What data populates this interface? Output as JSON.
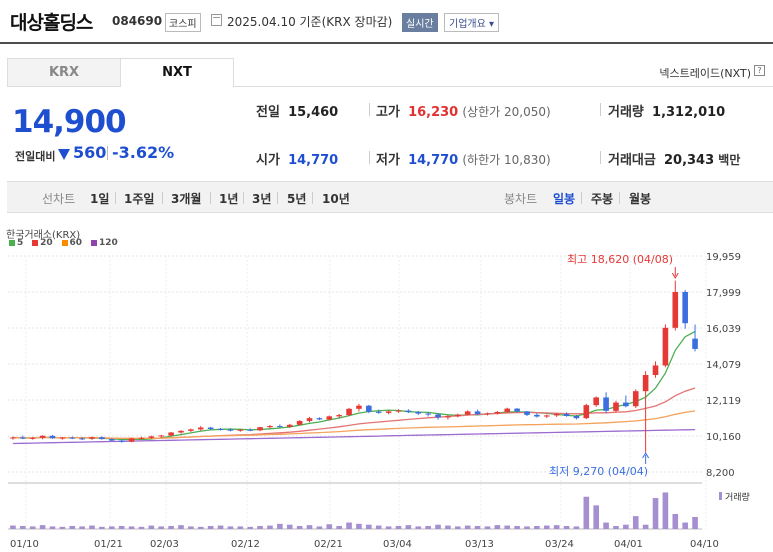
{
  "header": {
    "company_name": "대상홀딩스",
    "code": "084690",
    "market": "코스피",
    "date_text": "2025.04.10 기준(KRX 장마감)",
    "live_label": "실시간",
    "overview_label": "기업개요 ▾"
  },
  "tabs": [
    {
      "label": "KRX",
      "selected": false
    },
    {
      "label": "NXT",
      "selected": true
    }
  ],
  "nxt_link": "넥스트레이드(NXT)",
  "help_icon": "?",
  "summary": {
    "price": "14,900",
    "change_label": "전일대비",
    "change_value": "560",
    "change_pct": "-3.62%",
    "direction": "down"
  },
  "stats": {
    "prev_label": "전일",
    "prev": "15,460",
    "high_label": "고가",
    "high": "16,230",
    "upper_limit_text": "(상한가 20,050)",
    "volume_label": "거래량",
    "volume": "1,312,010",
    "open_label": "시가",
    "open": "14,770",
    "low_label": "저가",
    "low": "14,770",
    "lower_limit_text": "(하한가 10,830)",
    "amount_label": "거래대금",
    "amount": "20,343",
    "amount_unit": "백만"
  },
  "periods": {
    "line_label": "선차트",
    "line_items": [
      "1일",
      "1주일",
      "3개월",
      "1년",
      "3년",
      "5년",
      "10년"
    ],
    "candle_label": "봉차트",
    "candle_items": [
      "일봉",
      "주봉",
      "월봉"
    ],
    "active_candle": "일봉"
  },
  "chart": {
    "source_label": "한국거래소(KRX)",
    "ma_legend": [
      {
        "label": "5",
        "color": "#4caf50"
      },
      {
        "label": "20",
        "color": "#e53935"
      },
      {
        "label": "60",
        "color": "#fb8c00"
      },
      {
        "label": "120",
        "color": "#8e44ad"
      }
    ],
    "y_ticks": [
      "19,959",
      "17,999",
      "16,039",
      "14,079",
      "12,119",
      "10,160",
      "8,200"
    ],
    "x_ticks": [
      "01/10",
      "01/21",
      "02/03",
      "02/12",
      "02/21",
      "03/04",
      "03/13",
      "03/24",
      "04/01",
      "04/10"
    ],
    "high_note": "최고 18,620 (04/08)",
    "low_note": "최저 9,270 (04/04)",
    "volume_label": "거래량"
  },
  "chart_data": {
    "type": "candlestick",
    "y_range": [
      8200,
      19959
    ],
    "candles": [
      [
        10040,
        10120,
        9960,
        10080
      ],
      [
        10080,
        10180,
        9990,
        10020
      ],
      [
        10020,
        10110,
        9960,
        10060
      ],
      [
        10060,
        10200,
        9980,
        10170
      ],
      [
        10170,
        10210,
        10010,
        10040
      ],
      [
        10040,
        10110,
        9960,
        10070
      ],
      [
        10070,
        10130,
        9990,
        10030
      ],
      [
        10030,
        10100,
        9940,
        10010
      ],
      [
        10010,
        10130,
        9950,
        10090
      ],
      [
        10090,
        10140,
        9960,
        9990
      ],
      [
        9990,
        10040,
        9880,
        9910
      ],
      [
        9910,
        9960,
        9800,
        9850
      ],
      [
        9850,
        10070,
        9820,
        10030
      ],
      [
        10030,
        10120,
        9970,
        10060
      ],
      [
        10060,
        10180,
        10000,
        10140
      ],
      [
        10140,
        10220,
        10060,
        10190
      ],
      [
        10190,
        10380,
        10140,
        10350
      ],
      [
        10350,
        10470,
        10280,
        10440
      ],
      [
        10440,
        10560,
        10380,
        10520
      ],
      [
        10520,
        10700,
        10450,
        10620
      ],
      [
        10620,
        10660,
        10480,
        10540
      ],
      [
        10540,
        10600,
        10460,
        10510
      ],
      [
        10510,
        10590,
        10410,
        10450
      ],
      [
        10450,
        10550,
        10390,
        10500
      ],
      [
        10500,
        10580,
        10420,
        10470
      ],
      [
        10470,
        10660,
        10420,
        10640
      ],
      [
        10640,
        10760,
        10570,
        10700
      ],
      [
        10700,
        10790,
        10620,
        10660
      ],
      [
        10660,
        10820,
        10610,
        10770
      ],
      [
        10770,
        11020,
        10740,
        10980
      ],
      [
        10980,
        11200,
        10900,
        11130
      ],
      [
        11130,
        11180,
        11020,
        11060
      ],
      [
        11060,
        11280,
        11010,
        11230
      ],
      [
        11230,
        11360,
        11150,
        11300
      ],
      [
        11300,
        11690,
        11240,
        11640
      ],
      [
        11640,
        11900,
        11500,
        11810
      ],
      [
        11810,
        11850,
        11400,
        11480
      ],
      [
        11480,
        11600,
        11370,
        11420
      ],
      [
        11420,
        11560,
        11340,
        11500
      ],
      [
        11500,
        11610,
        11420,
        11540
      ],
      [
        11540,
        11620,
        11410,
        11470
      ],
      [
        11470,
        11520,
        11300,
        11380
      ],
      [
        11380,
        11460,
        11220,
        11330
      ],
      [
        11330,
        11400,
        11050,
        11170
      ],
      [
        11170,
        11290,
        11060,
        11230
      ],
      [
        11230,
        11380,
        11180,
        11320
      ],
      [
        11320,
        11560,
        11280,
        11500
      ],
      [
        11500,
        11590,
        11300,
        11350
      ],
      [
        11350,
        11440,
        11280,
        11390
      ],
      [
        11390,
        11520,
        11330,
        11470
      ],
      [
        11470,
        11700,
        11430,
        11650
      ],
      [
        11650,
        11680,
        11430,
        11500
      ],
      [
        11500,
        11520,
        11250,
        11310
      ],
      [
        11310,
        11400,
        11160,
        11220
      ],
      [
        11220,
        11330,
        11140,
        11280
      ],
      [
        11280,
        11420,
        11200,
        11360
      ],
      [
        11360,
        11450,
        11210,
        11250
      ],
      [
        11250,
        11310,
        11060,
        11130
      ],
      [
        11130,
        11910,
        11080,
        11840
      ],
      [
        11840,
        12310,
        11750,
        12260
      ],
      [
        12260,
        12540,
        11400,
        11530
      ],
      [
        11530,
        12080,
        11450,
        11980
      ],
      [
        11980,
        12360,
        11720,
        11780
      ],
      [
        11780,
        12700,
        11680,
        12600
      ],
      [
        12600,
        13690,
        9270,
        13480
      ],
      [
        13480,
        14220,
        13330,
        14000
      ],
      [
        14000,
        16230,
        13900,
        16050
      ],
      [
        16050,
        18620,
        15900,
        18000
      ],
      [
        18000,
        18100,
        16000,
        16300
      ],
      [
        15460,
        16230,
        14770,
        14900
      ]
    ],
    "volume": [
      0.08,
      0.07,
      0.06,
      0.09,
      0.06,
      0.05,
      0.07,
      0.06,
      0.08,
      0.05,
      0.06,
      0.07,
      0.06,
      0.05,
      0.08,
      0.06,
      0.07,
      0.09,
      0.06,
      0.05,
      0.07,
      0.08,
      0.06,
      0.06,
      0.05,
      0.07,
      0.08,
      0.12,
      0.1,
      0.07,
      0.09,
      0.06,
      0.11,
      0.07,
      0.15,
      0.12,
      0.1,
      0.08,
      0.06,
      0.07,
      0.09,
      0.06,
      0.07,
      0.1,
      0.08,
      0.06,
      0.08,
      0.07,
      0.06,
      0.09,
      0.08,
      0.07,
      0.06,
      0.07,
      0.08,
      0.09,
      0.07,
      0.06,
      0.75,
      0.55,
      0.15,
      0.07,
      0.1,
      0.3,
      0.1,
      0.72,
      0.85,
      0.35,
      0.15,
      0.28
    ]
  }
}
